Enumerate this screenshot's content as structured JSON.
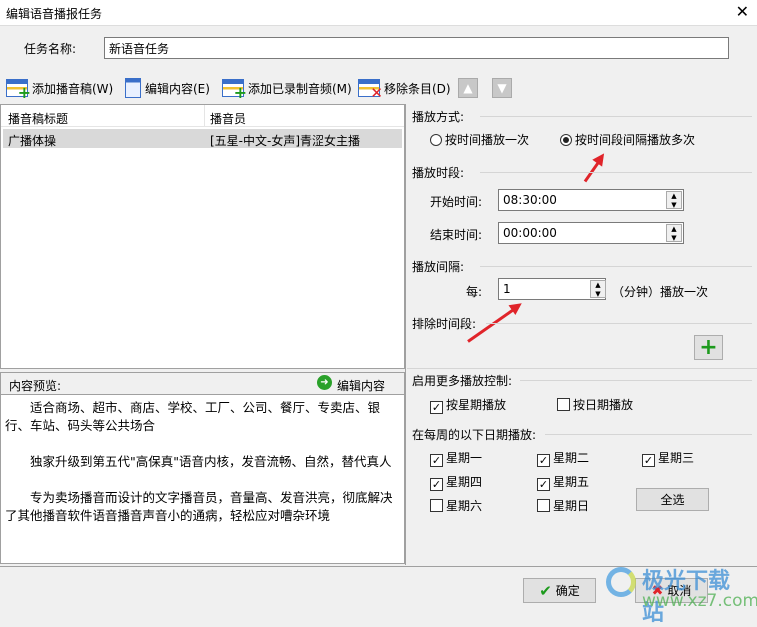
{
  "window": {
    "title": "编辑语音播报任务",
    "close": "✕"
  },
  "task": {
    "label": "任务名称:",
    "value": "新语音任务"
  },
  "toolbar": {
    "add_script": "添加播音稿(W)",
    "edit_content": "编辑内容(E)",
    "add_recorded": "添加已录制音频(M)",
    "remove": "移除条目(D)"
  },
  "list": {
    "headers": [
      "播音稿标题",
      "播音员"
    ],
    "rows": [
      {
        "title": "广播体操",
        "speaker": "[五星-中文-女声]青涩女主播"
      }
    ]
  },
  "preview": {
    "label": "内容预览:",
    "edit": "编辑内容",
    "paragraphs": [
      "适合商场、超市、商店、学校、工厂、公司、餐厅、专卖店、银行、车站、码头等公共场合",
      "独家升级到第五代\"高保真\"语音内核，发音流畅、自然，替代真人",
      "专为卖场播音而设计的文字播音员，音量高、发音洪亮，彻底解决了其他播音软件语音播音声音小的通病，轻松应对嘈杂环境"
    ]
  },
  "mode": {
    "label": "播放方式:",
    "once": "按时间播放一次",
    "repeat": "按时间段间隔播放多次",
    "selected": "repeat"
  },
  "period": {
    "label": "播放时段:",
    "start_label": "开始时间:",
    "start": "08:30:00",
    "end_label": "结束时间:",
    "end": "00:00:00"
  },
  "interval": {
    "label": "播放间隔:",
    "every": "每:",
    "value": "1",
    "unit": "（分钟）播放一次"
  },
  "exclude": {
    "label": "排除时间段:"
  },
  "more": {
    "label": "启用更多播放控制:",
    "by_week": "按星期播放",
    "by_week_checked": true,
    "by_date": "按日期播放",
    "by_date_checked": false
  },
  "week": {
    "label": "在每周的以下日期播放:",
    "days": [
      {
        "name": "星期一",
        "checked": true
      },
      {
        "name": "星期二",
        "checked": true
      },
      {
        "name": "星期三",
        "checked": true
      },
      {
        "name": "星期四",
        "checked": true
      },
      {
        "name": "星期五",
        "checked": true
      },
      {
        "name": "星期六",
        "checked": false
      },
      {
        "name": "星期日",
        "checked": false
      }
    ],
    "select_all": "全选"
  },
  "footer": {
    "ok": "确定",
    "cancel": "取消"
  },
  "watermark": {
    "text": "极光下载站",
    "url": "www.xz7.com"
  }
}
